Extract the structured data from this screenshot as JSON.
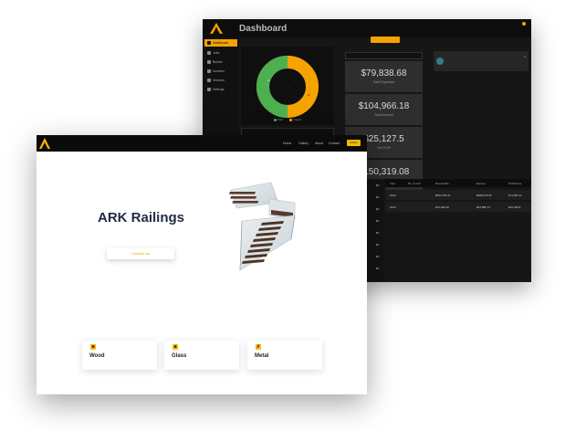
{
  "dashboard": {
    "title": "Dashboard",
    "user_line1": "",
    "sidebar": [
      {
        "label": "Dashboard",
        "icon": "grid-icon",
        "active": true
      },
      {
        "label": "Jobs",
        "icon": "briefcase-icon"
      },
      {
        "label": "Builder",
        "icon": "chart-icon"
      },
      {
        "label": "Invoices",
        "icon": "document-icon"
      },
      {
        "label": "Vendors",
        "icon": "users-icon"
      },
      {
        "label": "Settings",
        "icon": "gear-icon"
      }
    ],
    "add_button": "",
    "donut": {
      "label": "",
      "center": "Paid",
      "legend": [
        "Paid",
        "",
        "Unpaid"
      ],
      "colors": {
        "paid": "#4caf50",
        "unpaid": "#f5a300"
      }
    },
    "period_select": "",
    "stats": {
      "select": "",
      "cards": [
        {
          "value": "$79,838.68",
          "label": "Total Expenses",
          "accent": false
        },
        {
          "value": "$104,966.18",
          "label": "Total Amount",
          "accent": false
        },
        {
          "value": "$25,127.5",
          "label": "Net Profit",
          "accent": true
        },
        {
          "value": "$150,319.08",
          "label": "Outstanding Amount",
          "accent": true
        }
      ]
    },
    "activity": {
      "title": "",
      "lines": []
    },
    "table": {
      "headers": [
        "Year",
        "No. of Job",
        "Receivable",
        "Earned",
        "Profit/Loss"
      ],
      "rows": [
        [
          "2022",
          "",
          "$593,786.31",
          "$688,006.56",
          "$73,863.11"
        ],
        [
          "2024",
          "",
          "$70,996.90",
          "$24,886.74",
          "$35,459.8"
        ]
      ],
      "left_col": [
        "$0",
        "$0",
        "$0",
        "$0",
        "$0",
        "$0",
        "$0",
        "$0"
      ]
    }
  },
  "site": {
    "nav": [
      "Home",
      "Gallery",
      "About",
      "Contact"
    ],
    "nav_button": "Admin",
    "hero_title": "ARK Railings",
    "hero_subtitle": "",
    "cta": "Contact Us",
    "features": [
      {
        "label": "Wood",
        "icon": "wood-icon"
      },
      {
        "label": "Glass",
        "icon": "glass-icon"
      },
      {
        "label": "Metal",
        "icon": "metal-icon"
      }
    ],
    "accent": "#f5b800"
  }
}
